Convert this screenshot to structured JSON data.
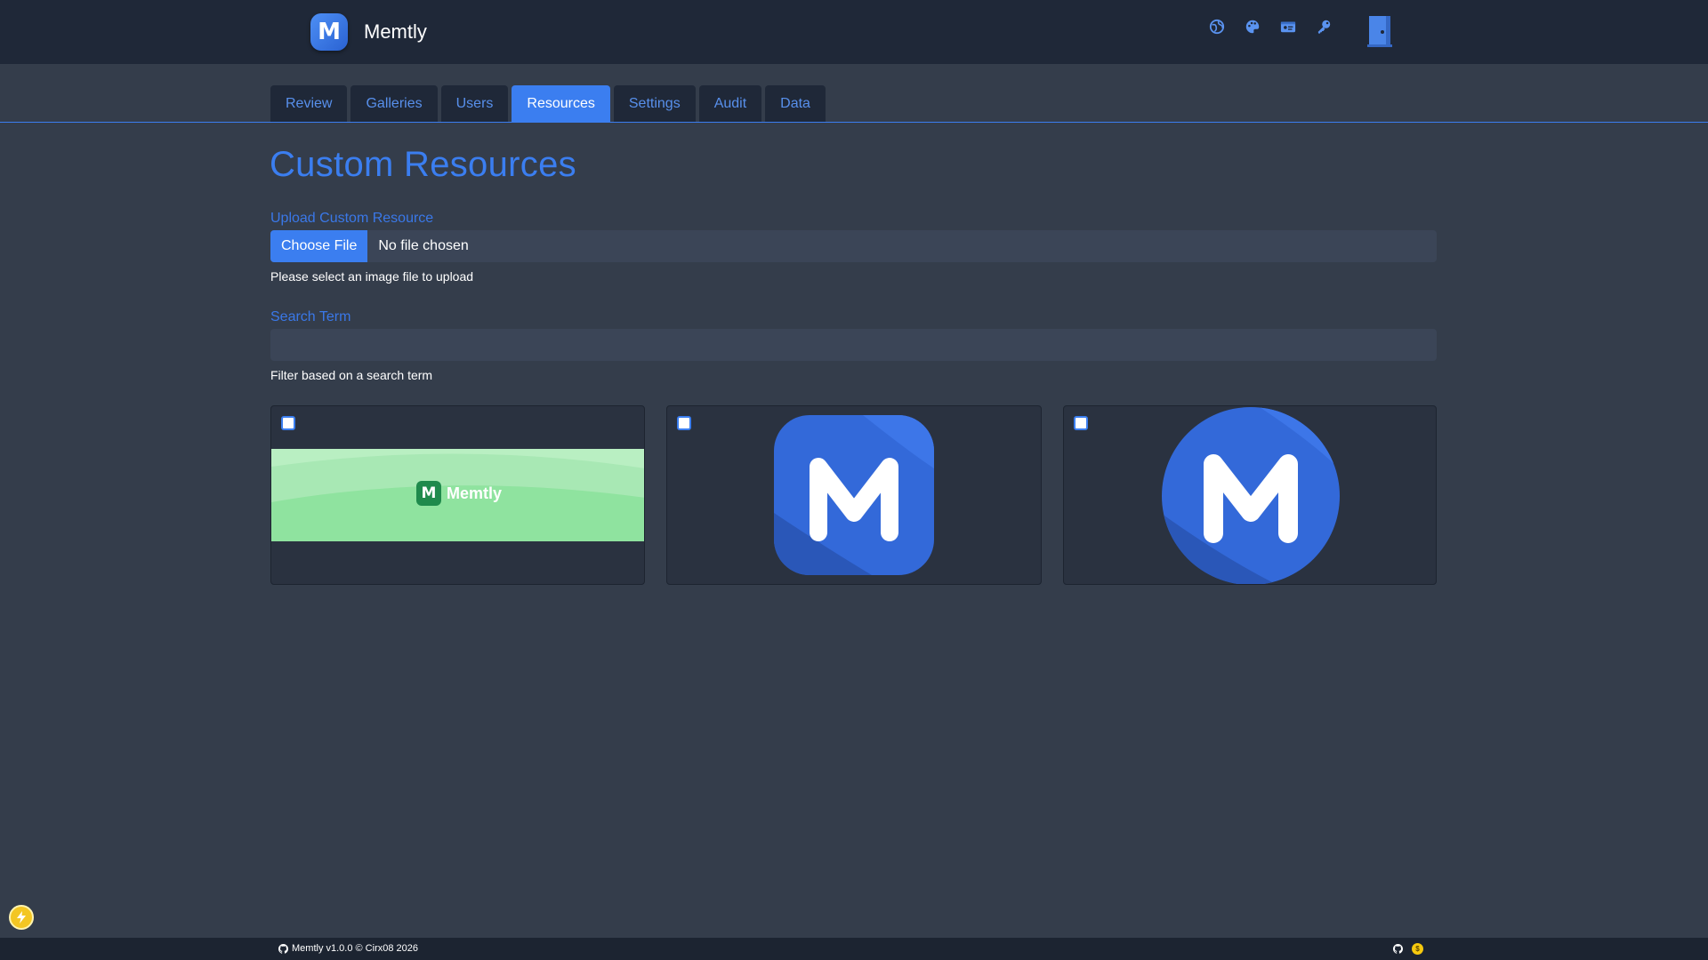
{
  "app": {
    "name": "Memtly",
    "logo_letter": "M"
  },
  "nav": {
    "icons": [
      "globe-icon",
      "palette-icon",
      "id-card-icon",
      "key-icon"
    ],
    "logout_icon": "door-icon"
  },
  "tabs": [
    {
      "label": "Review",
      "active": false
    },
    {
      "label": "Galleries",
      "active": false
    },
    {
      "label": "Users",
      "active": false
    },
    {
      "label": "Resources",
      "active": true
    },
    {
      "label": "Settings",
      "active": false
    },
    {
      "label": "Audit",
      "active": false
    },
    {
      "label": "Data",
      "active": false
    }
  ],
  "page": {
    "title": "Custom Resources"
  },
  "upload": {
    "label": "Upload Custom Resource",
    "button_label": "Choose File",
    "status": "No file chosen",
    "help": "Please select an image file to upload"
  },
  "search": {
    "label": "Search Term",
    "value": "",
    "placeholder": "",
    "help": "Filter based on a search term"
  },
  "resources": [
    {
      "kind": "banner",
      "logo_letter": "M",
      "logo_text": "Memtly",
      "selected": false
    },
    {
      "kind": "rounded-square-logo",
      "logo_letter": "M",
      "selected": false
    },
    {
      "kind": "circle-logo",
      "logo_letter": "M",
      "selected": false
    }
  ],
  "footer": {
    "text": "Memtly v1.0.0 © Cirx08 2026"
  },
  "colors": {
    "accent": "#3b7ef0",
    "navbar": "#1f2838",
    "background": "#343d4b",
    "card": "#2a3240",
    "banner_green": "#8fe39f"
  }
}
